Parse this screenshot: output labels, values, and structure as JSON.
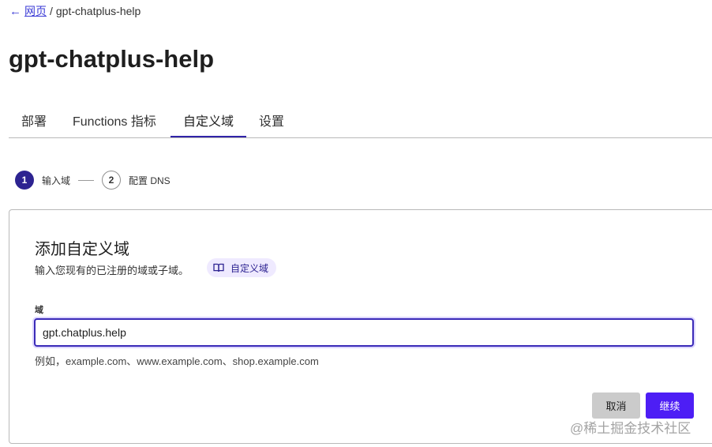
{
  "breadcrumb": {
    "back_label": "网页",
    "separator": "/",
    "current": "gpt-chatplus-help"
  },
  "page_title": "gpt-chatplus-help",
  "tabs": [
    {
      "label": "部署",
      "active": false
    },
    {
      "label": "Functions 指标",
      "active": false
    },
    {
      "label": "自定义域",
      "active": true
    },
    {
      "label": "设置",
      "active": false
    }
  ],
  "stepper": {
    "steps": [
      {
        "number": "1",
        "label": "输入域",
        "active": true
      },
      {
        "number": "2",
        "label": "配置 DNS",
        "active": false
      }
    ]
  },
  "card": {
    "title": "添加自定义域",
    "description": "输入您现有的已注册的域或子域。",
    "doc_badge": "自定义域",
    "field_label": "域",
    "field_value": "gpt.chatplus.help",
    "hint": "例如，example.com、www.example.com、shop.example.com",
    "cancel_label": "取消",
    "continue_label": "继续"
  },
  "watermark": "@稀土掘金技术社区",
  "colors": {
    "accent": "#3124a8",
    "primary_button": "#4d1ef5",
    "badge_bg": "#efeaff"
  }
}
